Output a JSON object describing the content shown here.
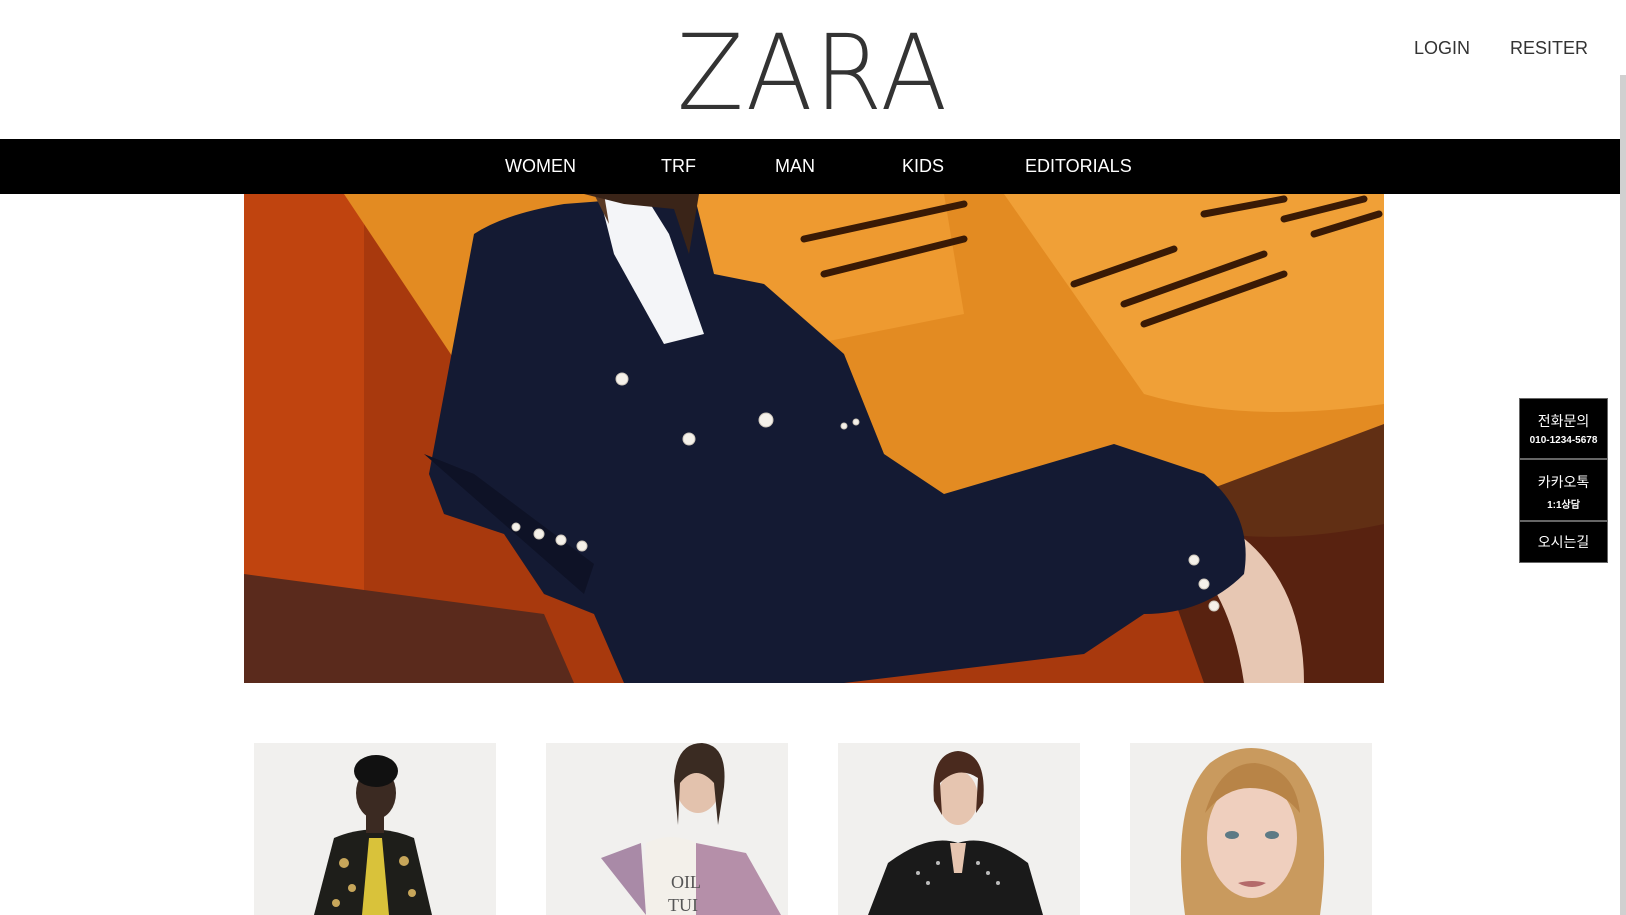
{
  "header": {
    "logo": "ZARA",
    "login": "LOGIN",
    "register": "RESITER"
  },
  "nav": {
    "items": [
      "WOMEN",
      "TRF",
      "MAN",
      "KIDS",
      "EDITORIALS"
    ]
  },
  "side_panel": {
    "phone_label": "전화문의",
    "phone_number": "010-1234-5678",
    "kakao_label": "카카오톡",
    "kakao_sub": "1:1상담",
    "directions_label": "오시는길"
  },
  "products": {
    "items": [
      {
        "icon": "model-paisley-jacket-photo"
      },
      {
        "icon": "model-tweed-jacket-photo"
      },
      {
        "icon": "model-leather-jacket-photo"
      },
      {
        "icon": "model-portrait-photo"
      }
    ]
  },
  "colors": {
    "nav_bg": "#000000",
    "nav_text": "#ffffff",
    "hero_orange": "#e58a1f",
    "suit_navy": "#141a33"
  }
}
